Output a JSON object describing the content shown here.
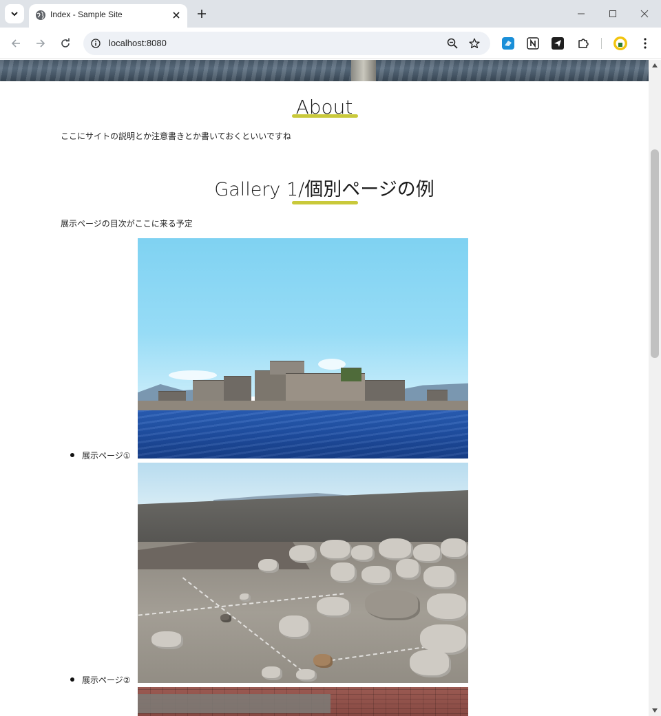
{
  "browser": {
    "tab_title": "Index - Sample Site",
    "url": "localhost:8080"
  },
  "icons": {
    "tab_search": "chevron-down-icon",
    "favicon": "globe-icon",
    "tab_close": "close-icon",
    "new_tab": "plus-icon",
    "back": "arrow-left-icon",
    "forward": "arrow-right-icon",
    "reload": "reload-icon",
    "site_info": "info-icon",
    "zoom": "zoom-out-icon",
    "bookmark": "star-icon",
    "extensions": [
      "translate-extension-icon",
      "notion-extension-icon",
      "send-extension-icon",
      "puzzle-icon"
    ],
    "profile": "profile-avatar-icon",
    "menu": "kebab-menu-icon"
  },
  "colors": {
    "tab_bar": "#dfe3e8",
    "omnibox": "#eef1f6",
    "heading_underline": "#c9c93a",
    "profile_avatar": "#f2c40f"
  },
  "page": {
    "about": {
      "heading": "About",
      "text": "ここにサイトの説明とか注意書きとか書いておくといいですね"
    },
    "gallery": {
      "heading": "Gallery 1/個別ページの例",
      "intro": "展示ページの目次がここに来る予定",
      "items": [
        {
          "label": "展示ページ①"
        },
        {
          "label": "展示ページ②"
        }
      ]
    }
  }
}
